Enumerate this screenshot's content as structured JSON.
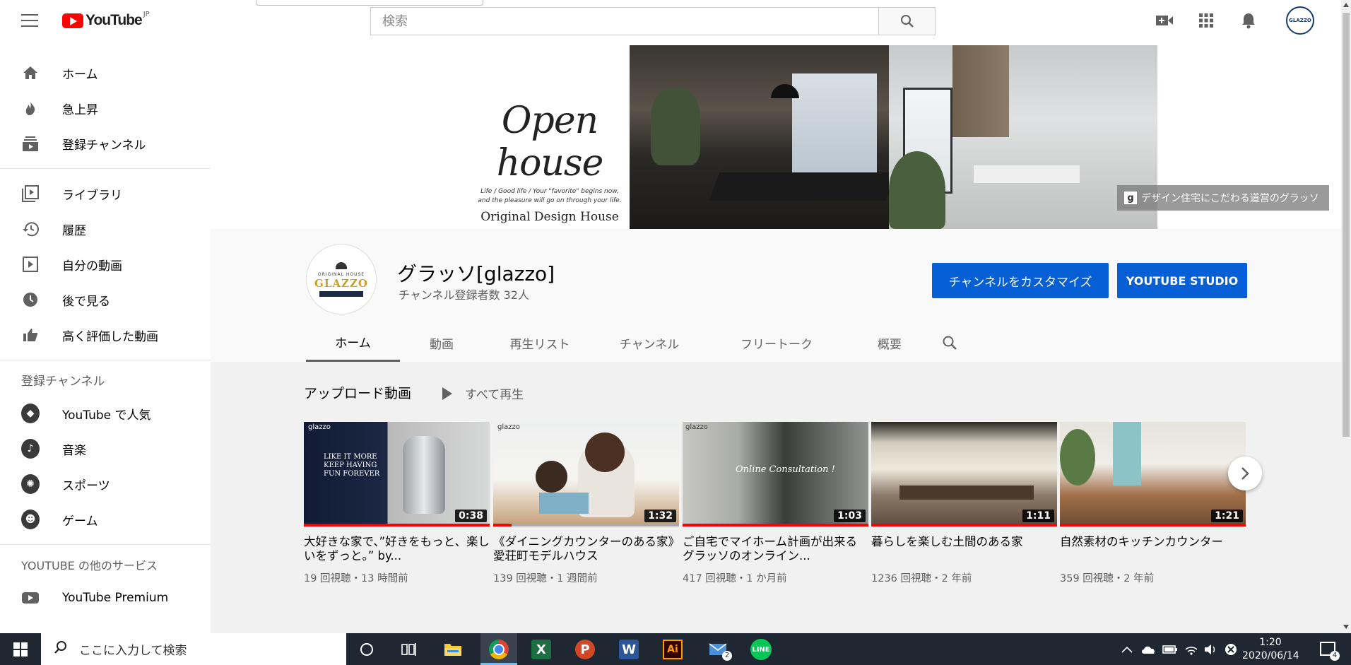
{
  "header": {
    "logo_text": "YouTube",
    "logo_region": "JP",
    "search_placeholder": "検索",
    "avatar_text": "GLAZZO"
  },
  "sidebar": {
    "main": [
      {
        "label": "ホーム",
        "icon": "home-icon"
      },
      {
        "label": "急上昇",
        "icon": "fire-icon"
      },
      {
        "label": "登録チャンネル",
        "icon": "subscriptions-icon"
      }
    ],
    "library": [
      {
        "label": "ライブラリ",
        "icon": "library-icon"
      },
      {
        "label": "履歴",
        "icon": "history-icon"
      },
      {
        "label": "自分の動画",
        "icon": "my-videos-icon"
      },
      {
        "label": "後で見る",
        "icon": "clock-icon"
      },
      {
        "label": "高く評価した動画",
        "icon": "thumbs-up-icon"
      }
    ],
    "subscriptions_heading": "登録チャンネル",
    "subscriptions": [
      {
        "label": "YouTube で人気",
        "icon": "popular-icon"
      },
      {
        "label": "音楽",
        "icon": "music-icon"
      },
      {
        "label": "スポーツ",
        "icon": "sports-icon"
      },
      {
        "label": "ゲーム",
        "icon": "gaming-icon"
      }
    ],
    "more_heading": "YOUTUBE の他のサービス",
    "more": [
      {
        "label": "YouTube Premium",
        "icon": "youtube-premium-icon"
      }
    ]
  },
  "banner": {
    "title": "Open house",
    "tagline_1": "Life / Good life / Your \"favorite\" begins now,",
    "tagline_2": "and the pleasure will go on through your life.",
    "brand": "Original Design House",
    "tag_letter": "g",
    "tag_text": "デザイン住宅にこだわる道営のグラッソ"
  },
  "channel": {
    "avatar_top": "ORIGINAL HOUSE",
    "avatar_name": "GLAZZO",
    "name": "グラッソ[glazzo]",
    "subscribers": "チャンネル登録者数 32人",
    "customize_label": "チャンネルをカスタマイズ",
    "studio_label": "YOUTUBE STUDIO",
    "tabs": [
      "ホーム",
      "動画",
      "再生リスト",
      "チャンネル",
      "フリートーク",
      "概要"
    ]
  },
  "uploads": {
    "title": "アップロード動画",
    "play_all": "すべて再生",
    "videos": [
      {
        "title": "大好きな家で、”好きをもっと、楽しいをずっと。” by...",
        "meta": "19 回視聴・13 時間前",
        "duration": "0:38",
        "progress": 1.0,
        "overlay": "LIKE IT MORE\nKEEP HAVING\nFUN FOREVER",
        "brand": "glazzo"
      },
      {
        "title": "《ダイニングカウンターのある家》愛荘町モデルハウス",
        "meta": "139 回視聴・1 週間前",
        "duration": "1:32",
        "progress": 0.1,
        "overlay": "",
        "brand": "glazzo"
      },
      {
        "title": "ご自宅でマイホーム計画が出来るグラッソのオンライン...",
        "meta": "417 回視聴・1 か月前",
        "duration": "1:03",
        "progress": 1.0,
        "overlay": "Online Consultation !",
        "brand": "glazzo"
      },
      {
        "title": "暮らしを楽しむ土間のある家",
        "meta": "1236 回視聴・2 年前",
        "duration": "1:11",
        "progress": 1.0,
        "overlay": "",
        "brand": ""
      },
      {
        "title": "自然素材のキッチンカウンター",
        "meta": "359 回視聴・2 年前",
        "duration": "1:21",
        "progress": 1.0,
        "overlay": "",
        "brand": ""
      }
    ]
  },
  "taskbar": {
    "search_placeholder": "ここに入力して検索",
    "time": "1:20",
    "date": "2020/06/14",
    "mail_badge": "2",
    "notification_count": "4"
  },
  "colors": {
    "accent_blue": "#065fd4",
    "youtube_red": "#ff0000",
    "taskbar": "#1f2733"
  }
}
